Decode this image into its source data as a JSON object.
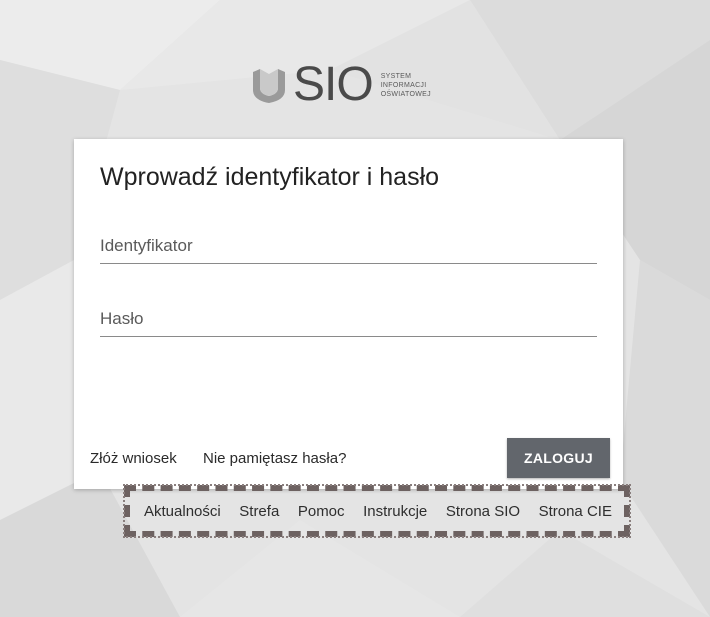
{
  "logo": {
    "name": "SIO",
    "sub_line1": "SYSTEM",
    "sub_line2": "INFORMACJI",
    "sub_line3": "OŚWIATOWEJ",
    "icon": "book-shield-icon"
  },
  "login": {
    "title": "Wprowadź identyfikator i hasło",
    "id_placeholder": "Identyfikator",
    "id_value": "",
    "password_placeholder": "Hasło",
    "password_value": "",
    "apply_link": "Złóż wniosek",
    "forgot_link": "Nie pamiętasz hasła?",
    "submit_label": "ZALOGUJ"
  },
  "footer": {
    "links": [
      "Aktualności",
      "Strefa",
      "Pomoc",
      "Instrukcje",
      "Strona SIO",
      "Strona CIE"
    ]
  },
  "colors": {
    "background": "#e3e3e3",
    "button": "#62666c",
    "highlight_border": "#6d6261"
  }
}
